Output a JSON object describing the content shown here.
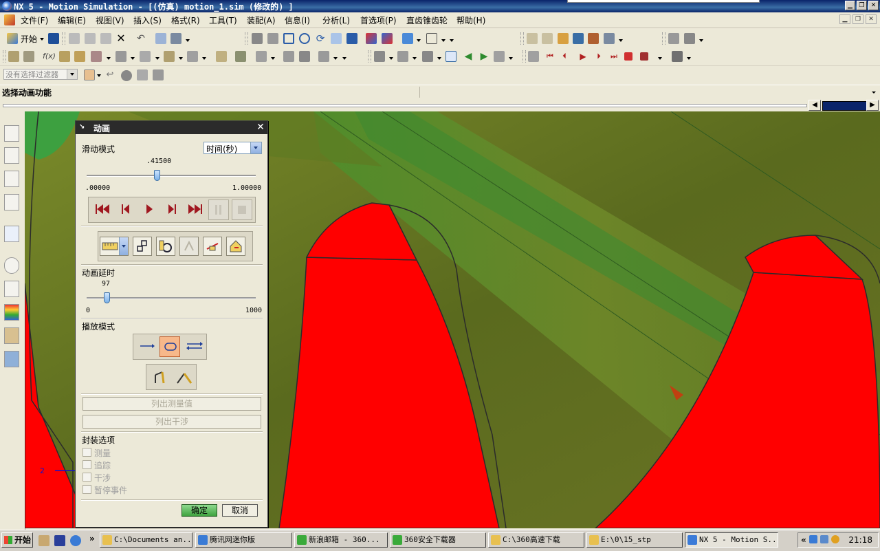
{
  "window": {
    "title": "NX 5 - Motion Simulation - [(仿真) motion_1.sim (修改的) ]"
  },
  "menu": [
    "文件(F)",
    "编辑(E)",
    "视图(V)",
    "插入(S)",
    "格式(R)",
    "工具(T)",
    "装配(A)",
    "信息(I)",
    "分析(L)",
    "首选项(P)",
    "直齿锥齿轮",
    "帮助(H)"
  ],
  "toolbar": {
    "start_label": "开始"
  },
  "filter": {
    "placeholder": "没有选择过滤器"
  },
  "cue": {
    "text": "选择动画功能"
  },
  "dialog": {
    "title": "动画",
    "slide_mode_label": "滑动模式",
    "slide_mode_value": "时间(秒)",
    "time_value": ".41500",
    "time_fraction": 0.415,
    "time_min": ".00000",
    "time_max": "1.00000",
    "delay_label": "动画延时",
    "delay_value": "97",
    "delay_min": "0",
    "delay_max": "1000",
    "play_mode_label": "播放模式",
    "list_measure": "列出测量值",
    "list_interference": "列出干涉",
    "package_label": "封装选项",
    "options": [
      "测量",
      "追踪",
      "干涉",
      "暂停事件"
    ],
    "ok": "确定",
    "cancel": "取消"
  },
  "viewport": {
    "axis_label": "2"
  },
  "taskbar": {
    "start": "开始",
    "quicklaunch_more": "»",
    "tasks": [
      {
        "label": "C:\\Documents an..."
      },
      {
        "label": "腾讯网迷你版"
      },
      {
        "label": "新浪邮箱 - 360..."
      },
      {
        "label": "360安全下载器"
      },
      {
        "label": "C:\\360高速下载"
      },
      {
        "label": "E:\\0\\15_stp"
      },
      {
        "label": "NX 5 - Motion S..."
      }
    ],
    "tray_more": "«",
    "clock": "21:18"
  },
  "colors": {
    "accent": "#0a246a",
    "gear_red": "#ff0000",
    "shaft_olive": "#6b7a22",
    "shaft_green": "#3d8a2e"
  }
}
